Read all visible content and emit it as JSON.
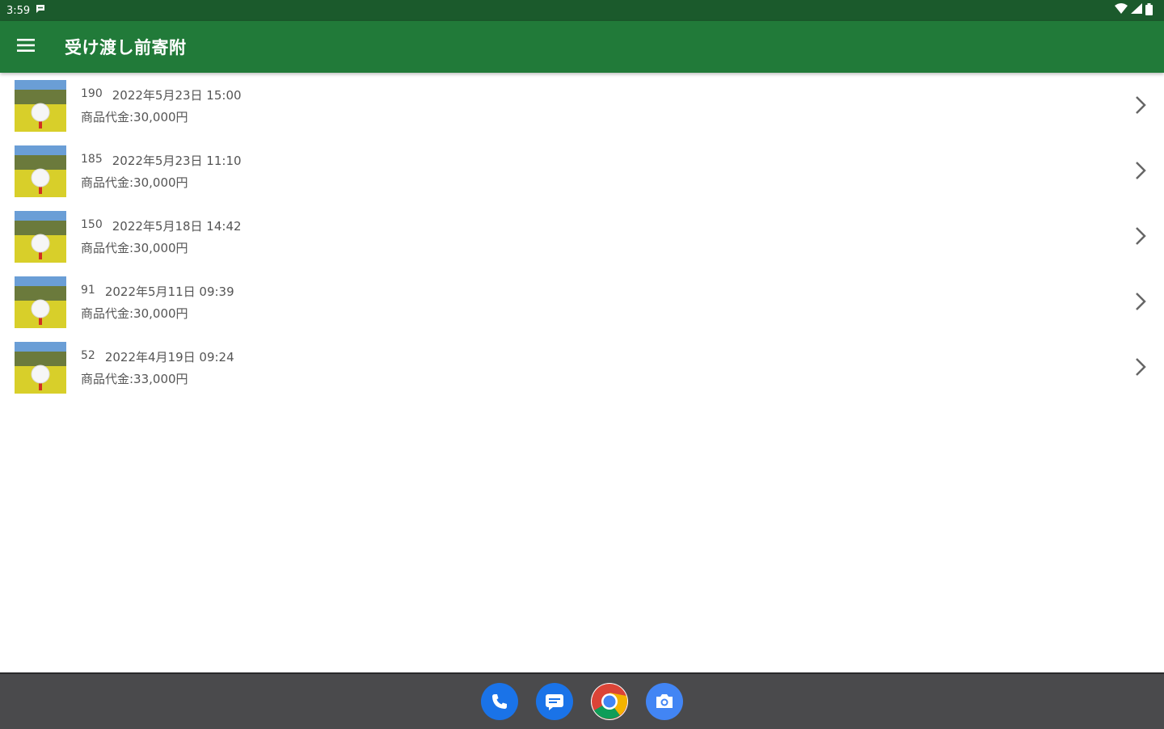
{
  "status_bar": {
    "time": "3:59",
    "icons": [
      "message-notification-icon",
      "wifi-icon",
      "signal-icon",
      "battery-icon"
    ]
  },
  "app_bar": {
    "title": "受け渡し前寄附",
    "menu_icon": "hamburger-menu-icon",
    "color": "#217a39",
    "status_color": "#1b5a2c"
  },
  "items": [
    {
      "id": "190",
      "date": "2022年5月23日 15:00",
      "price": "商品代金:30,000円"
    },
    {
      "id": "185",
      "date": "2022年5月23日 11:10",
      "price": "商品代金:30,000円"
    },
    {
      "id": "150",
      "date": "2022年5月18日 14:42",
      "price": "商品代金:30,000円"
    },
    {
      "id": "91",
      "date": "2022年5月11日 09:39",
      "price": "商品代金:30,000円"
    },
    {
      "id": "52",
      "date": "2022年4月19日 09:24",
      "price": "商品代金:33,000円"
    }
  ],
  "dock": [
    "phone-icon",
    "messages-icon",
    "chrome-icon",
    "camera-icon"
  ]
}
